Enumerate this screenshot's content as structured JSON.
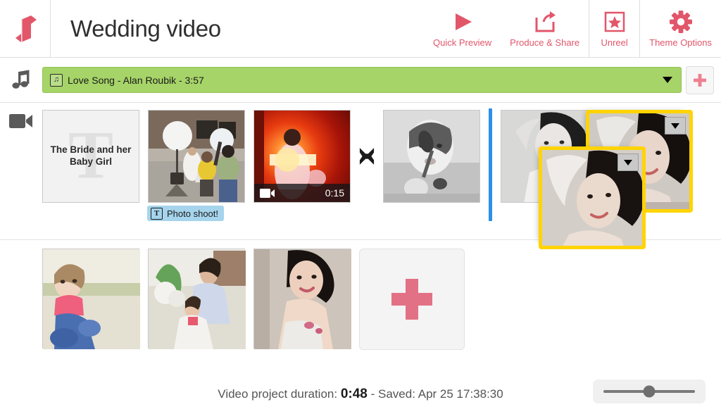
{
  "app": {
    "logo_icon": "film-ribbon-logo",
    "accent_color": "#e2566a",
    "music_bar_color": "#a6d468",
    "selection_color": "#ffd400",
    "drop_marker_color": "#2b8fe8"
  },
  "header": {
    "project_title": "Wedding video",
    "tools": [
      {
        "label": "Quick Preview",
        "icon": "play-icon"
      },
      {
        "label": "Produce & Share",
        "icon": "share-export-icon"
      },
      {
        "label": "Unreel",
        "icon": "star-box-icon"
      },
      {
        "label": "Theme Options",
        "icon": "gear-icon"
      }
    ]
  },
  "music_track": {
    "rail_icon": "music-note-icon",
    "chip_icon": "music-note-small-icon",
    "label": "Love Song - Alan Roubik - 3:57",
    "dropdown_icon": "caret-down-icon",
    "add_button_icon": "plus-icon"
  },
  "storyboard": {
    "rail_icon": "video-camera-icon",
    "clips": [
      {
        "type": "title-card",
        "title_text": "The Bride and her Baby Girl",
        "watermark": "T"
      },
      {
        "type": "photo",
        "caption_icon": "text-title-icon",
        "caption": "Photo shoot!"
      },
      {
        "type": "video",
        "duration": "0:15",
        "badge_icon": "video-camera-icon"
      },
      {
        "type": "transition",
        "icon": "bowtie-transition-icon"
      },
      {
        "type": "photo"
      },
      {
        "type": "drop-marker"
      },
      {
        "type": "photo"
      },
      {
        "type": "photo",
        "selected": true,
        "menu_icon": "caret-down-icon"
      },
      {
        "type": "photo",
        "selected": true,
        "dragging": true,
        "menu_icon": "caret-down-icon"
      }
    ]
  },
  "media_tray": {
    "items": [
      {
        "type": "photo"
      },
      {
        "type": "photo"
      },
      {
        "type": "photo"
      }
    ],
    "add_tile_icon": "plus-icon"
  },
  "footer": {
    "duration_label": "Video project duration:",
    "duration_value": "0:48",
    "separator": "-",
    "saved_label": "Saved:",
    "saved_value": "Apr 25 17:38:30",
    "zoom_slider": {
      "name": "thumbnail-size-slider",
      "position_percent": 50
    }
  }
}
